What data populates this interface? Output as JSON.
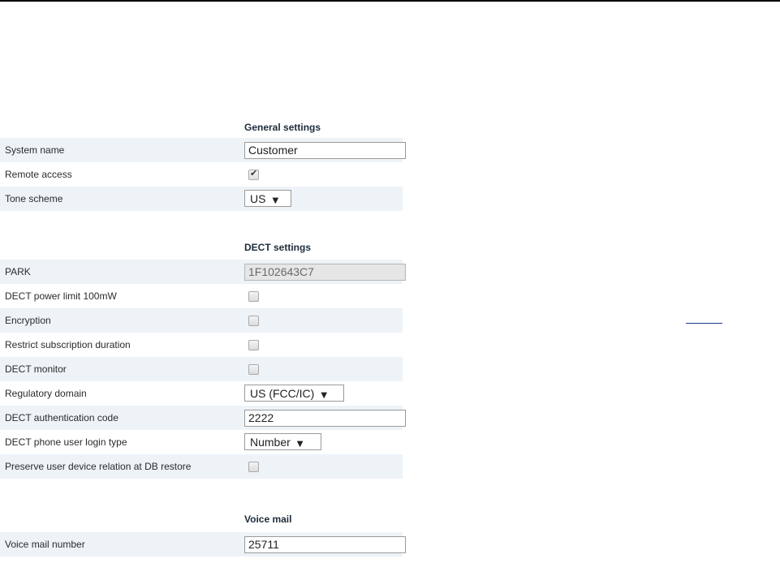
{
  "sections": {
    "general": "General settings",
    "dect": "DECT settings",
    "voicemail": "Voice mail"
  },
  "general": {
    "system_name": {
      "label": "System name",
      "value": "Customer"
    },
    "remote_access": {
      "label": "Remote access",
      "checked": true
    },
    "tone_scheme": {
      "label": "Tone scheme",
      "value": "US"
    }
  },
  "dect": {
    "park": {
      "label": "PARK",
      "value": "1F102643C7"
    },
    "power_limit": {
      "label": "DECT power limit 100mW",
      "checked": false
    },
    "encryption": {
      "label": "Encryption",
      "checked": false
    },
    "restrict_sub": {
      "label": "Restrict subscription duration",
      "checked": false
    },
    "monitor": {
      "label": "DECT monitor",
      "checked": false
    },
    "regulatory": {
      "label": "Regulatory domain",
      "value": "US (FCC/IC)"
    },
    "auth_code": {
      "label": "DECT authentication code",
      "value": "2222"
    },
    "login_type": {
      "label": "DECT phone user login type",
      "value": "Number"
    },
    "preserve": {
      "label": "Preserve user device relation at DB restore",
      "checked": false
    }
  },
  "voicemail": {
    "number": {
      "label": "Voice mail number",
      "value": "25711"
    }
  },
  "icons": {
    "dropdown": "triangle-down-icon",
    "check": "checkmark-icon"
  }
}
